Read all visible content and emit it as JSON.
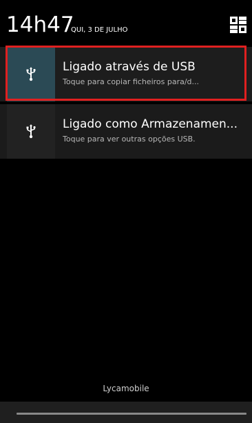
{
  "header": {
    "time": "14h47",
    "date": "QUI, 3 DE JULHO",
    "settings_icon": "quick-settings-icon"
  },
  "notifications": [
    {
      "icon": "usb-icon",
      "title": "Ligado através de USB",
      "subtitle": "Toque para copiar ficheiros para/d..."
    },
    {
      "icon": "usb-icon",
      "title": "Ligado como Armazenamen...",
      "subtitle": "Toque para ver outras opções USB."
    }
  ],
  "footer": {
    "carrier": "Lycamobile"
  },
  "colors": {
    "highlight": "#e02020",
    "selected_icon_bg": "#2b4a55"
  }
}
